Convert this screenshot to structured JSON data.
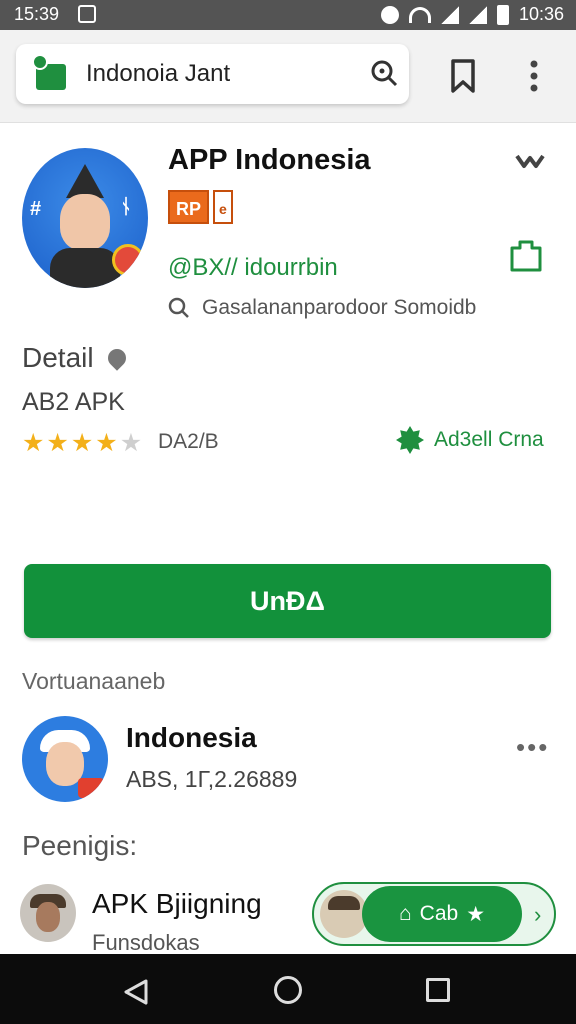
{
  "status_bar": {
    "time_left": "15:39",
    "time_right": "10:36"
  },
  "browser": {
    "url_text": "Indonoia Jant"
  },
  "app": {
    "title": "APP Indonesia",
    "tag_primary": "RP",
    "tag_secondary": "e",
    "developer": "@BX// idourrbin",
    "search_text": "Gasalananparodoor Somoidb"
  },
  "detail": {
    "heading": "Detail",
    "version": "AB2 APK",
    "rating_value": 4,
    "rating_max": 5,
    "rating_text": "DA2/B",
    "verified_text": "Ad3ell Crna"
  },
  "download_button": {
    "label": "UnĐΔ"
  },
  "related": {
    "section_label": "Vortuanaaneb",
    "title": "Indonesia",
    "subtitle": "ABS, 1Γ,2.26889"
  },
  "peers": {
    "section_label": "Peenigis:",
    "title": "APK Bjiigning",
    "subtitle": "Funsdokas",
    "chip_label": "Cab"
  },
  "colors": {
    "accent_green": "#12913b",
    "tag_orange": "#ea6a1c",
    "star_gold": "#f3b01a"
  },
  "icons": [
    "site-icon",
    "search-icon",
    "bookmark-icon",
    "more-vert-icon",
    "chevron-down-icon",
    "share-icon",
    "location-pin-icon",
    "verified-badge-icon",
    "back-icon",
    "home-icon",
    "recents-icon"
  ]
}
